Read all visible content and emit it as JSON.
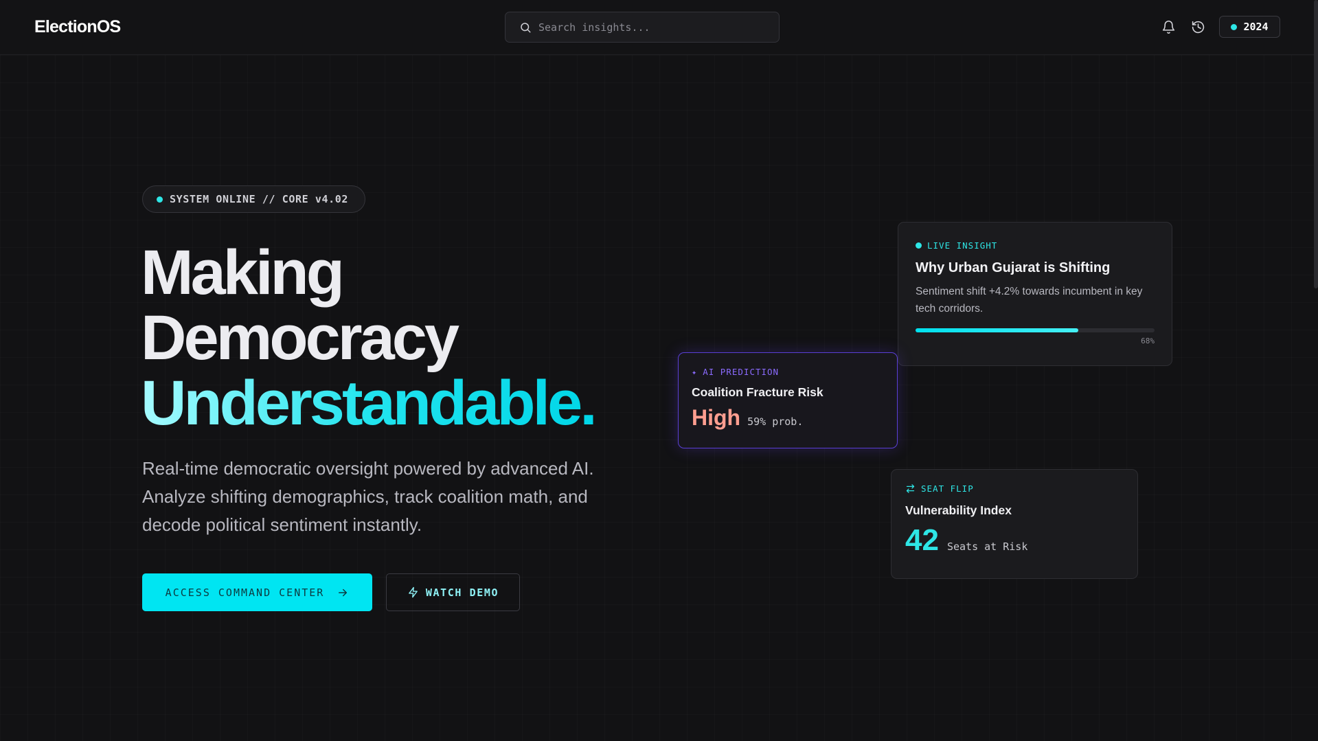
{
  "header": {
    "logo": "ElectionOS",
    "search_placeholder": "Search insights...",
    "year": "2024",
    "icons": [
      "bell-icon",
      "history-icon"
    ]
  },
  "hero": {
    "status": "SYSTEM ONLINE // CORE v4.02",
    "headline": [
      "Making",
      "Democracy",
      "Understandable."
    ],
    "subtitle": "Real-time democratic oversight powered by advanced AI. Analyze shifting demographics, track coalition math, and decode political sentiment instantly.",
    "primary_cta": "ACCESS COMMAND CENTER",
    "secondary_cta": "WATCH DEMO"
  },
  "cards": {
    "live_insight": {
      "tag": "LIVE INSIGHT",
      "title": "Why Urban Gujarat is Shifting",
      "body": "Sentiment shift +4.2% towards incumbent in key tech corridors.",
      "progress": 0.68,
      "progress_label": "68%"
    },
    "ai_prediction": {
      "tag": "AI PREDICTION",
      "title": "Coalition Fracture Risk",
      "value": "High",
      "detail": "59% prob."
    },
    "seat_flip": {
      "tag": "SEAT FLIP",
      "title": "Vulnerability Index",
      "value": "42",
      "detail": "Seats at Risk"
    }
  },
  "colors": {
    "accent": "#00e5f2",
    "ai_purple": "#8b6bff",
    "risk": "#ff9e90",
    "background": "#121214"
  }
}
